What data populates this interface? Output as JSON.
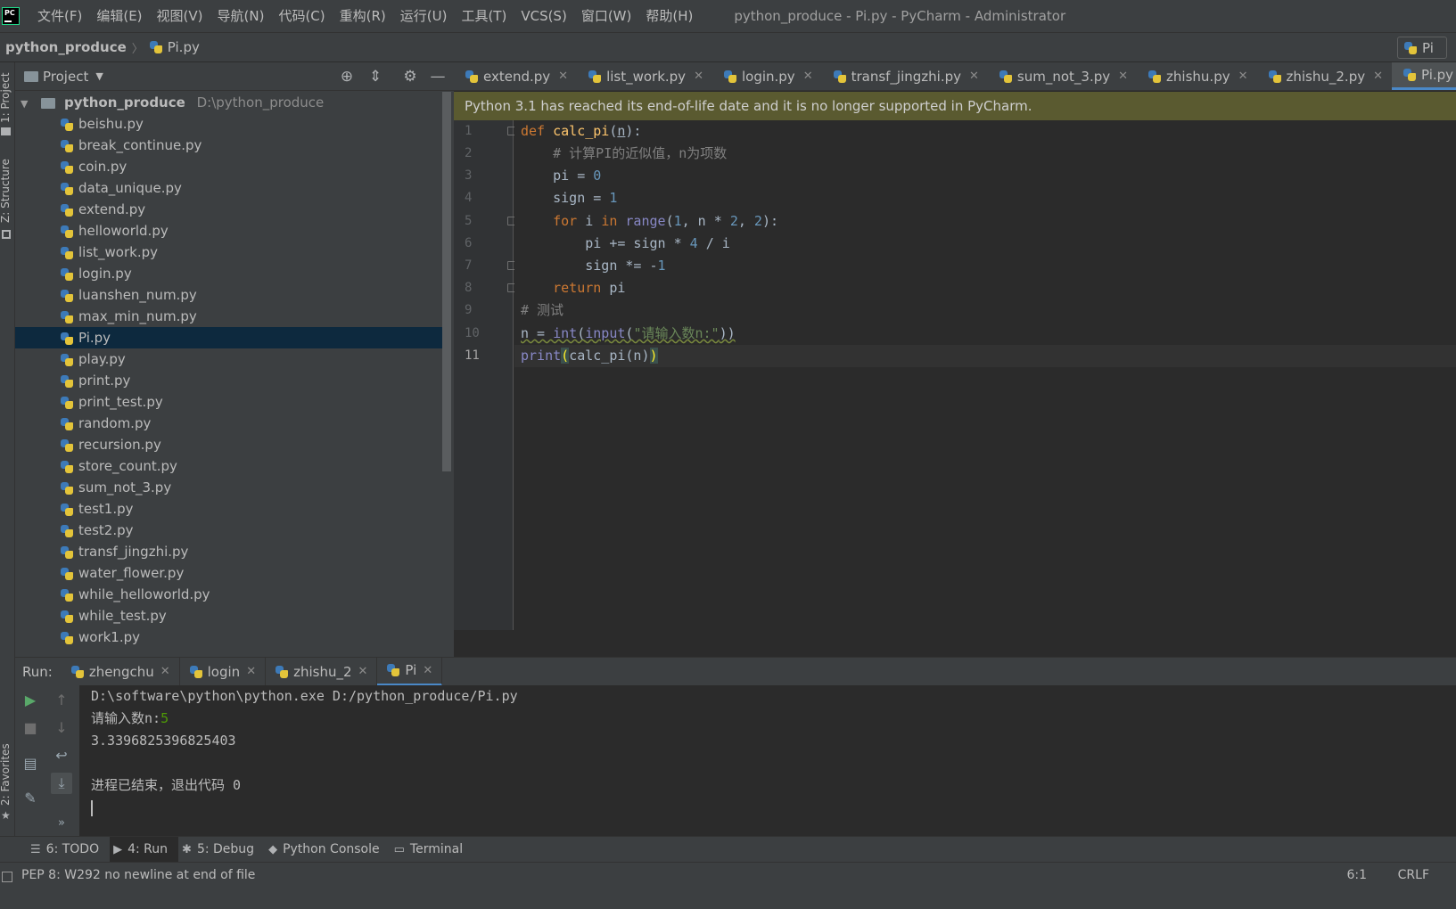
{
  "window_title": "python_produce - Pi.py - PyCharm - Administrator",
  "menu": [
    "文件(F)",
    "编辑(E)",
    "视图(V)",
    "导航(N)",
    "代码(C)",
    "重构(R)",
    "运行(U)",
    "工具(T)",
    "VCS(S)",
    "窗口(W)",
    "帮助(H)"
  ],
  "navbar": {
    "project": "python_produce",
    "file": "Pi.py",
    "run_config": "Pi"
  },
  "left_strip": {
    "project": "1: Project",
    "structure": "Z: Structure",
    "favorites": "2: Favorites"
  },
  "project_panel": {
    "title": "Project",
    "root_name": "python_produce",
    "root_path": "D:\\python_produce",
    "files": [
      "beishu.py",
      "break_continue.py",
      "coin.py",
      "data_unique.py",
      "extend.py",
      "helloworld.py",
      "list_work.py",
      "login.py",
      "luanshen_num.py",
      "max_min_num.py",
      "Pi.py",
      "play.py",
      "print.py",
      "print_test.py",
      "random.py",
      "recursion.py",
      "store_count.py",
      "sum_not_3.py",
      "test1.py",
      "test2.py",
      "transf_jingzhi.py",
      "water_flower.py",
      "while_helloworld.py",
      "while_test.py",
      "work1.py"
    ],
    "selected_file": "Pi.py"
  },
  "editor_tabs": [
    "extend.py",
    "list_work.py",
    "login.py",
    "transf_jingzhi.py",
    "sum_not_3.py",
    "zhishu.py",
    "zhishu_2.py",
    "Pi.py"
  ],
  "active_editor_tab": "Pi.py",
  "eol_banner": "Python 3.1 has reached its end-of-life date and it is no longer supported in PyCharm.",
  "code": {
    "line_numbers": [
      "1",
      "2",
      "3",
      "4",
      "5",
      "6",
      "7",
      "8",
      "9",
      "10",
      "11"
    ],
    "current_line": "11",
    "comment_line2": "# 计算PI的近似值，n为项数",
    "comment_line9": "# 测试",
    "input_prompt": "\"请输入数n:\""
  },
  "run_panel": {
    "label": "Run:",
    "tabs": [
      "zhengchu",
      "login",
      "zhishu_2",
      "Pi"
    ],
    "active_tab": "Pi",
    "console": {
      "command": "D:\\software\\python\\python.exe D:/python_produce/Pi.py",
      "prompt": "请输入数n:",
      "input": "5",
      "result": "3.3396825396825403",
      "exit": "进程已结束，退出代码 0"
    }
  },
  "tool_windows": [
    {
      "label": "6: TODO",
      "icon": "list-icon",
      "active": false
    },
    {
      "label": "4: Run",
      "icon": "run-icon",
      "active": true
    },
    {
      "label": "5: Debug",
      "icon": "bug-icon",
      "active": false
    },
    {
      "label": "Python Console",
      "icon": "python-icon",
      "active": false
    },
    {
      "label": "Terminal",
      "icon": "terminal-icon",
      "active": false
    }
  ],
  "status": {
    "message": "PEP 8: W292 no newline at end of file",
    "position": "6:1",
    "line_separator": "CRLF"
  },
  "colors": {
    "accent": "#4a88c7",
    "selection": "#0d293e",
    "banner": "#5a5a30"
  }
}
